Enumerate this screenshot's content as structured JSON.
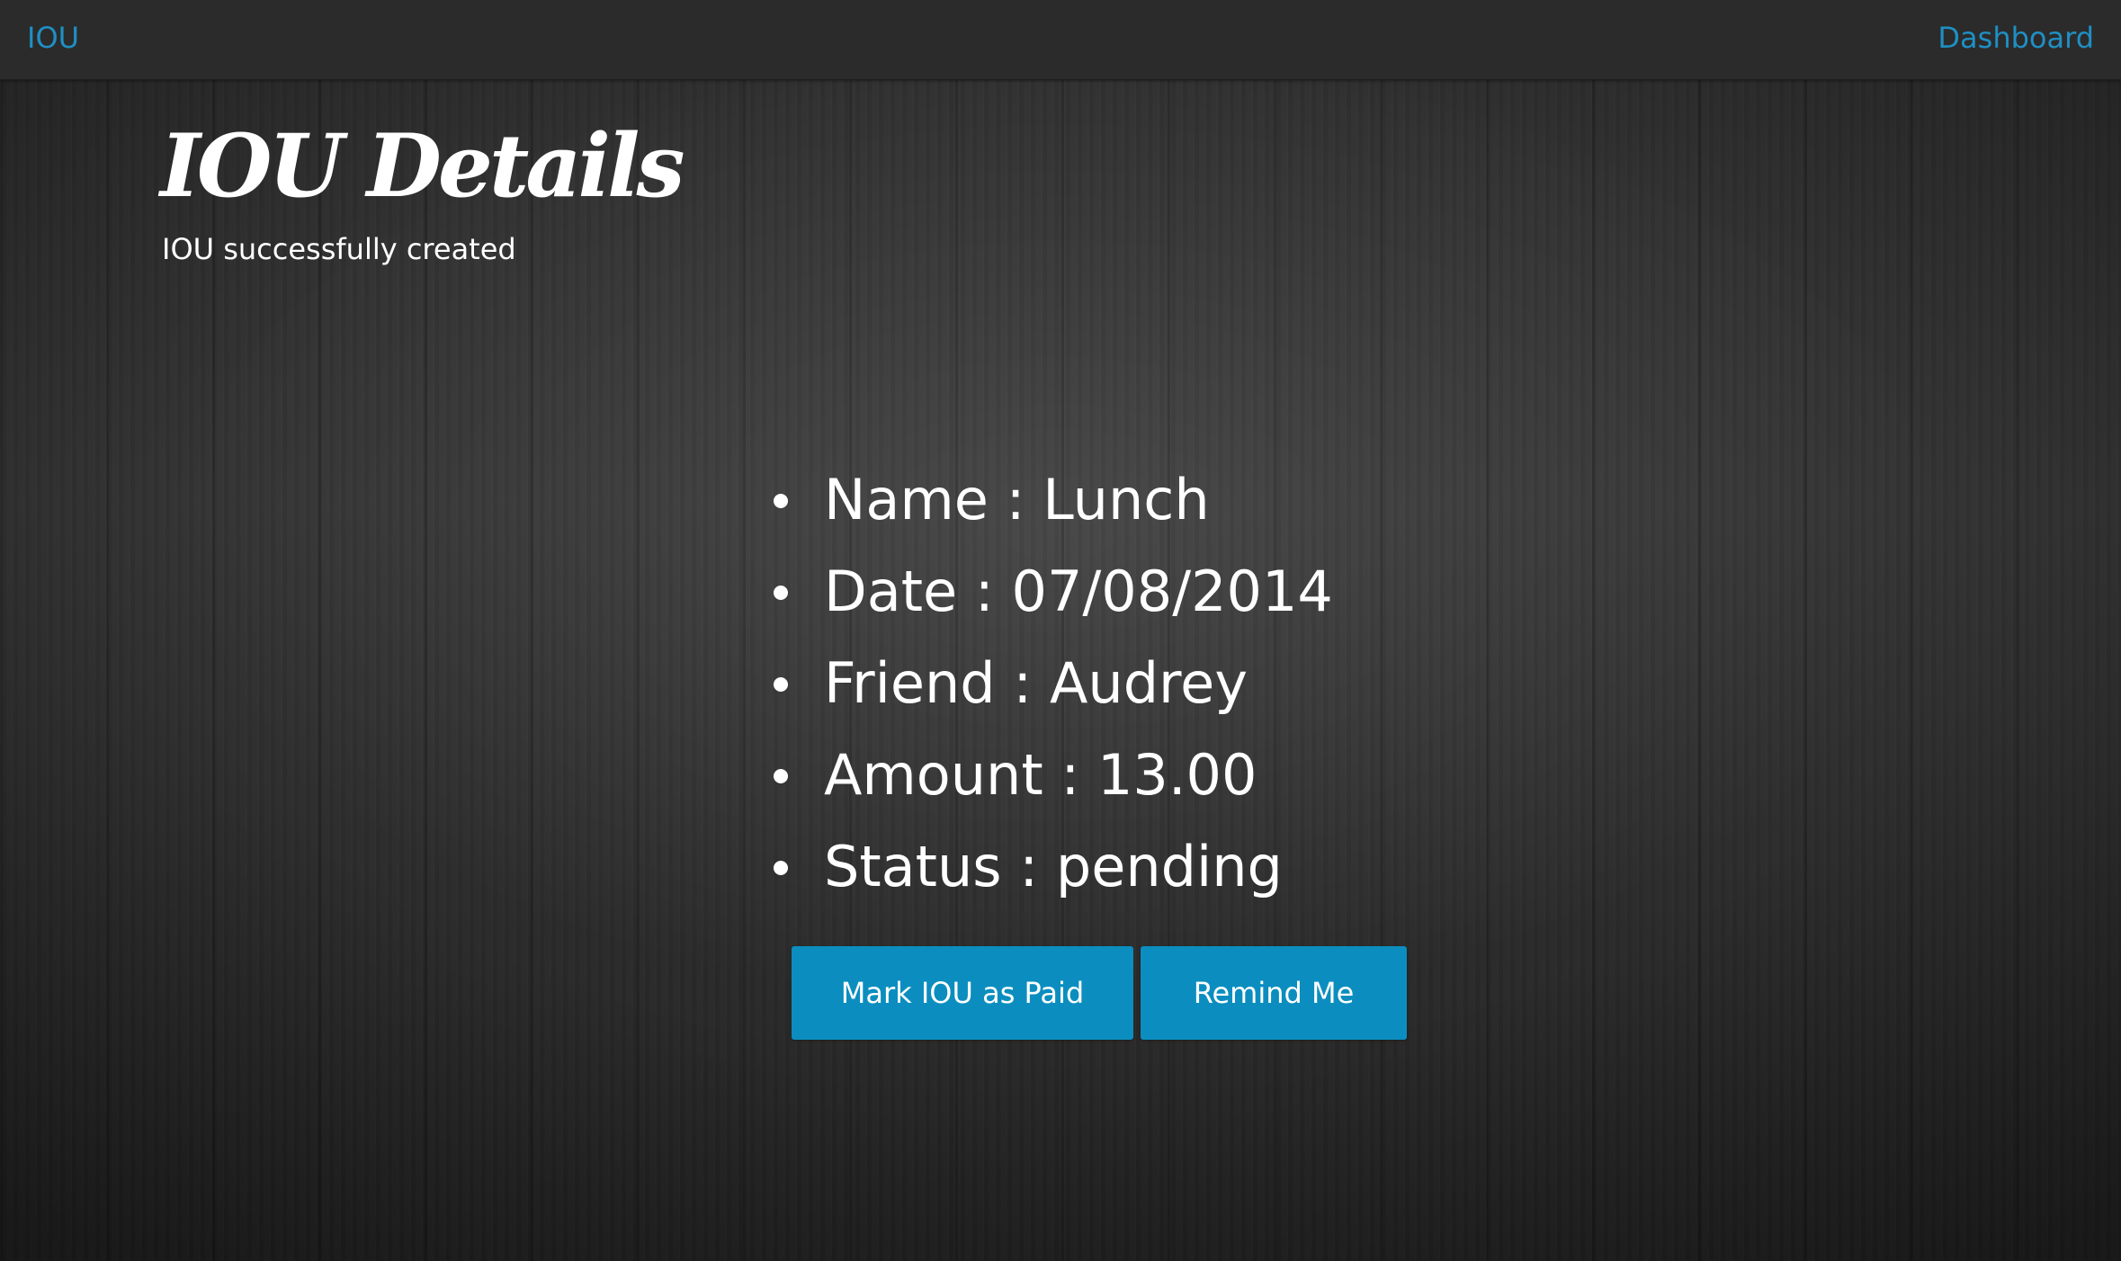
{
  "navbar": {
    "brand": "IOU",
    "dashboard_link": "Dashboard",
    "link_color": "#1f8fc4"
  },
  "header": {
    "title": "IOU Details",
    "flash_message": "IOU successfully created"
  },
  "details": [
    {
      "label": "Name",
      "value": "Lunch"
    },
    {
      "label": "Date",
      "value": "07/08/2014"
    },
    {
      "label": "Friend",
      "value": "Audrey"
    },
    {
      "label": "Amount",
      "value": "13.00"
    },
    {
      "label": "Status",
      "value": "pending"
    }
  ],
  "actions": {
    "mark_paid_label": "Mark IOU as Paid",
    "remind_label": "Remind Me",
    "button_color": "#0b8ebf"
  }
}
